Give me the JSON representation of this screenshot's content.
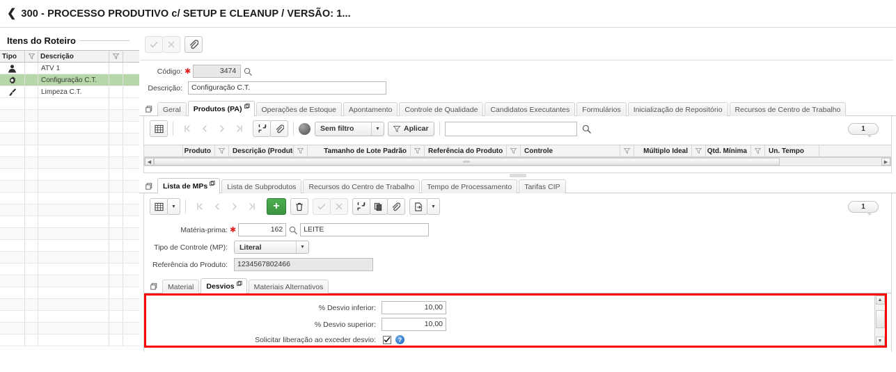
{
  "header": {
    "back_icon": "chevron-left-icon",
    "title": "300 - PROCESSO PRODUTIVO c/ SETUP E CLEANUP / VERSÃO: 1..."
  },
  "left_panel": {
    "legend": "Itens do Roteiro",
    "columns": [
      "Tipo",
      "Descrição"
    ],
    "rows": [
      {
        "icon": "person-icon",
        "descricao": "ATV 1",
        "selected": false
      },
      {
        "icon": "gear-icon",
        "descricao": "Configuração C.T.",
        "selected": true
      },
      {
        "icon": "brush-icon",
        "descricao": "Limpeza C.T.",
        "selected": false
      }
    ],
    "empty_rows": 21
  },
  "record_toolbar": {
    "confirm_label": "✓",
    "cancel_label": "✕",
    "attach_icon": "paperclip-icon"
  },
  "record_form": {
    "codigo_label": "Código:",
    "codigo_value": "3474",
    "codigo_required": "✱",
    "descricao_label": "Descrição:",
    "descricao_value": "Configuração C.T.",
    "lookup_icon": "magnifier-icon"
  },
  "main_tabs": {
    "corner_icon": "windows-restore-icon",
    "items": [
      {
        "label": "Geral",
        "active": false
      },
      {
        "label": "Produtos (PA)",
        "active": true
      },
      {
        "label": "Operações de Estoque",
        "active": false
      },
      {
        "label": "Apontamento",
        "active": false
      },
      {
        "label": "Controle de Qualidade",
        "active": false
      },
      {
        "label": "Candidatos Executantes",
        "active": false
      },
      {
        "label": "Formulários",
        "active": false
      },
      {
        "label": "Inicialização de Repositório",
        "active": false
      },
      {
        "label": "Recursos de Centro de Trabalho",
        "active": false
      }
    ]
  },
  "pa_toolbar": {
    "grid_icon": "grid-view-icon",
    "first_icon": "first-page-icon",
    "prev_icon": "previous-page-icon",
    "next_icon": "next-page-icon",
    "last_icon": "last-page-icon",
    "refresh_icon": "refresh-icon",
    "attach_icon": "paperclip-icon",
    "globe_icon": "globe-icon",
    "filter_value": "Sem filtro",
    "apply_label": "Aplicar",
    "apply_icon": "funnel-icon",
    "search_value": "",
    "search_icon": "magnifier-icon",
    "count_badge": "1"
  },
  "pa_grid": {
    "columns": [
      {
        "label": "Produto",
        "align": "right",
        "filter": true
      },
      {
        "label": "Descrição (Produto)",
        "align": "left",
        "filter": true
      },
      {
        "label": "Tamanho de Lote Padrão",
        "align": "right",
        "filter": true
      },
      {
        "label": "Referência do Produto",
        "align": "left",
        "filter": true
      },
      {
        "label": "Controle",
        "align": "left",
        "filter": true
      },
      {
        "label": "Múltiplo Ideal",
        "align": "right",
        "filter": true
      },
      {
        "label": "Qtd. Mínima",
        "align": "right",
        "filter": true
      },
      {
        "label": "Un. Tempo",
        "align": "left",
        "filter": false
      }
    ],
    "rows": []
  },
  "mp_tabs": {
    "corner_icon": "windows-restore-icon",
    "items": [
      {
        "label": "Lista de MPs",
        "active": true
      },
      {
        "label": "Lista de Subprodutos",
        "active": false
      },
      {
        "label": "Recursos do Centro de Trabalho",
        "active": false
      },
      {
        "label": "Tempo de Processamento",
        "active": false
      },
      {
        "label": "Tarifas CIP",
        "active": false
      }
    ]
  },
  "mp_toolbar": {
    "grid_icon": "grid-view-icon",
    "grid_dropdown_icon": "chevron-down-icon",
    "first_icon": "first-page-icon",
    "prev_icon": "previous-page-icon",
    "next_icon": "next-page-icon",
    "last_icon": "last-page-icon",
    "add_label": "+",
    "delete_icon": "trash-icon",
    "confirm_icon": "check-icon",
    "cancel_icon": "x-icon",
    "refresh_icon": "refresh-icon",
    "copy_icon": "copy-icon",
    "attach_icon": "paperclip-icon",
    "export_icon": "export-icon",
    "export_dropdown_icon": "chevron-down-icon",
    "count_badge": "1"
  },
  "mp_form": {
    "materia_prima_label": "Matéria-prima:",
    "materia_prima_required": "✱",
    "materia_prima_code": "162",
    "materia_prima_name": "LEITE",
    "lookup_icon": "magnifier-icon",
    "tipo_controle_label": "Tipo de Controle (MP):",
    "tipo_controle_value": "Literal",
    "referencia_label": "Referência do Produto:",
    "referencia_value": "1234567802466"
  },
  "desvio_tabs": {
    "corner_icon": "windows-restore-icon",
    "items": [
      {
        "label": "Material",
        "active": false
      },
      {
        "label": "Desvios",
        "active": true
      },
      {
        "label": "Materiais Alternativos",
        "active": false
      }
    ]
  },
  "desvios": {
    "highlight_color": "#ff0000",
    "desvio_inferior_label": "% Desvio inferior:",
    "desvio_inferior_value": "10,00",
    "desvio_superior_label": "% Desvio superior:",
    "desvio_superior_value": "10,00",
    "solicitar_label": "Solicitar liberação ao exceder desvio:",
    "solicitar_checked": "✔",
    "help_icon": "help-icon",
    "help_glyph": "?",
    "scroll_up_icon": "scroll-up-icon",
    "scroll_down_icon": "scroll-down-icon"
  }
}
